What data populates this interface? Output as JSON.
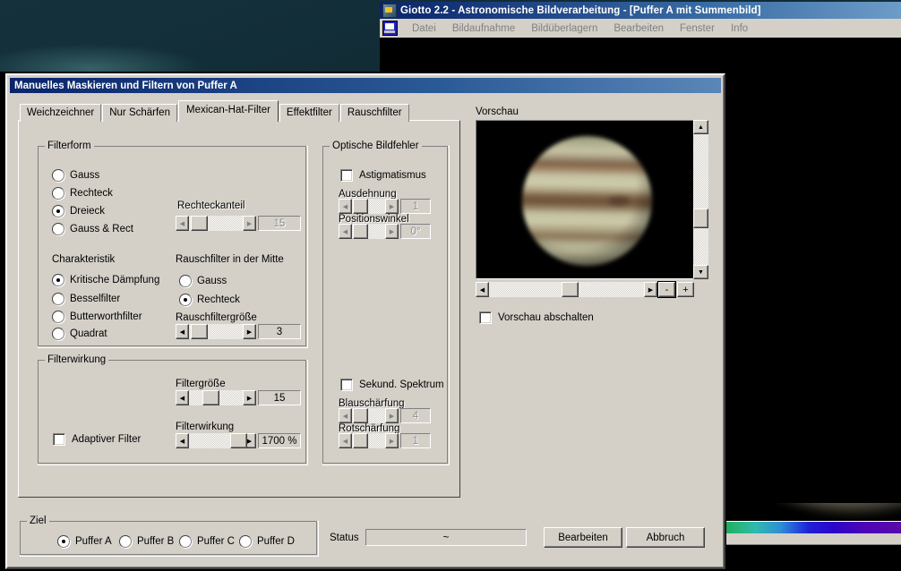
{
  "desktop": {
    "wallpaper": "marbled-teal"
  },
  "main_window": {
    "title": "Giotto 2.2 - Astronomische Bildverarbeitung - [Puffer A mit Summenbild]",
    "menu": [
      "Datei",
      "Bildaufnahme",
      "Bildüberlagern",
      "Bearbeiten",
      "Fenster",
      "Info"
    ]
  },
  "dialog": {
    "title": "Manuelles Maskieren und Filtern von Puffer A",
    "tabs": [
      {
        "label": "Weichzeichner",
        "active": false
      },
      {
        "label": "Nur Schärfen",
        "active": false
      },
      {
        "label": "Mexican-Hat-Filter",
        "active": true
      },
      {
        "label": "Effektfilter",
        "active": false
      },
      {
        "label": "Rauschfilter",
        "active": false
      }
    ],
    "filterform": {
      "legend": "Filterform",
      "options": [
        {
          "label": "Gauss",
          "selected": false
        },
        {
          "label": "Rechteck",
          "selected": false
        },
        {
          "label": "Dreieck",
          "selected": true
        },
        {
          "label": "Gauss & Rect",
          "selected": false
        }
      ],
      "rechteckanteil": {
        "label": "Rechteckanteil",
        "value": "15",
        "enabled": false,
        "thumb_pct": 6
      },
      "charakteristik": {
        "label": "Charakteristik",
        "options": [
          {
            "label": "Kritische Dämpfung",
            "selected": true
          },
          {
            "label": "Besselfilter",
            "selected": false
          },
          {
            "label": "Butterworthfilter",
            "selected": false
          },
          {
            "label": "Quadrat",
            "selected": false
          }
        ]
      },
      "rauschfilter_mitte": {
        "label": "Rauschfilter in der Mitte",
        "options": [
          {
            "label": "Gauss",
            "selected": false
          },
          {
            "label": "Rechteck",
            "selected": true
          }
        ],
        "groesse": {
          "label": "Rauschfiltergröße",
          "value": "3",
          "enabled": true,
          "thumb_pct": 5
        }
      }
    },
    "filterwirkung_group": {
      "legend": "Filterwirkung",
      "filtergroesse": {
        "label": "Filtergröße",
        "value": "15",
        "enabled": true,
        "thumb_pct": 27
      },
      "adaptiver_filter": {
        "label": "Adaptiver Filter",
        "checked": false
      },
      "filterwirkung": {
        "label": "Filterwirkung",
        "value": "1700 %",
        "enabled": true,
        "thumb_pct": 80
      }
    },
    "optische_bildfehler": {
      "legend": "Optische Bildfehler",
      "astigmatismus": {
        "label": "Astigmatismus",
        "checked": false
      },
      "ausdehnung": {
        "label": "Ausdehnung",
        "value": "1",
        "enabled": false,
        "thumb_pct": 6
      },
      "positionswinkel": {
        "label": "Positionswinkel",
        "value": "0°",
        "enabled": false,
        "thumb_pct": 6
      },
      "sekund_spektrum": {
        "label": "Sekund. Spektrum",
        "checked": false
      },
      "blauschaerfung": {
        "label": "Blauschärfung",
        "value": "4",
        "enabled": false,
        "thumb_pct": 6
      },
      "rotschaerfung": {
        "label": "Rotschärfung",
        "value": "1",
        "enabled": false,
        "thumb_pct": 6
      }
    },
    "preview": {
      "label": "Vorschau",
      "zoom_out_label": "-",
      "zoom_in_label": "+",
      "disable_checkbox": {
        "label": "Vorschau abschalten",
        "checked": false
      }
    },
    "ziel": {
      "legend": "Ziel",
      "options": [
        {
          "label": "Puffer A",
          "selected": true
        },
        {
          "label": "Puffer B",
          "selected": false
        },
        {
          "label": "Puffer C",
          "selected": false
        },
        {
          "label": "Puffer D",
          "selected": false
        }
      ]
    },
    "status": {
      "label": "Status",
      "value": "~"
    },
    "buttons": {
      "ok": "Bearbeiten",
      "cancel": "Abbruch"
    }
  }
}
